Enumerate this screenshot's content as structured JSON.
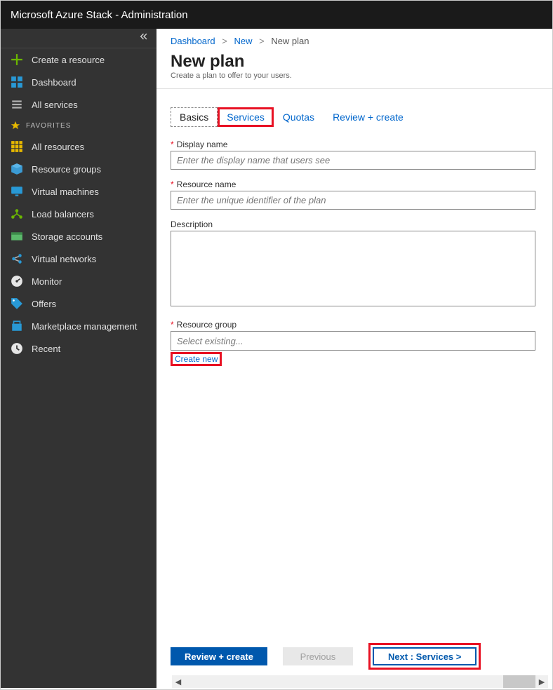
{
  "topbar": {
    "title": "Microsoft Azure Stack - Administration"
  },
  "sidebar": {
    "create": "Create a resource",
    "dashboard": "Dashboard",
    "all_services": "All services",
    "favorites_header": "FAVORITES",
    "items": [
      {
        "label": "All resources"
      },
      {
        "label": "Resource groups"
      },
      {
        "label": "Virtual machines"
      },
      {
        "label": "Load balancers"
      },
      {
        "label": "Storage accounts"
      },
      {
        "label": "Virtual networks"
      },
      {
        "label": "Monitor"
      },
      {
        "label": "Offers"
      },
      {
        "label": "Marketplace management"
      },
      {
        "label": "Recent"
      }
    ]
  },
  "breadcrumb": {
    "items": [
      "Dashboard",
      "New"
    ],
    "current": "New plan"
  },
  "page": {
    "title": "New plan",
    "subtitle": "Create a plan to offer to your users."
  },
  "tabs": {
    "basics": "Basics",
    "services": "Services",
    "quotas": "Quotas",
    "review": "Review + create"
  },
  "fields": {
    "display_name": {
      "label": "Display name",
      "placeholder": "Enter the display name that users see"
    },
    "resource_name": {
      "label": "Resource name",
      "placeholder": "Enter the unique identifier of the plan"
    },
    "description": {
      "label": "Description"
    },
    "resource_group": {
      "label": "Resource group",
      "placeholder": "Select existing...",
      "create_new": "Create new"
    }
  },
  "footer": {
    "review": "Review + create",
    "previous": "Previous",
    "next": "Next : Services >"
  }
}
